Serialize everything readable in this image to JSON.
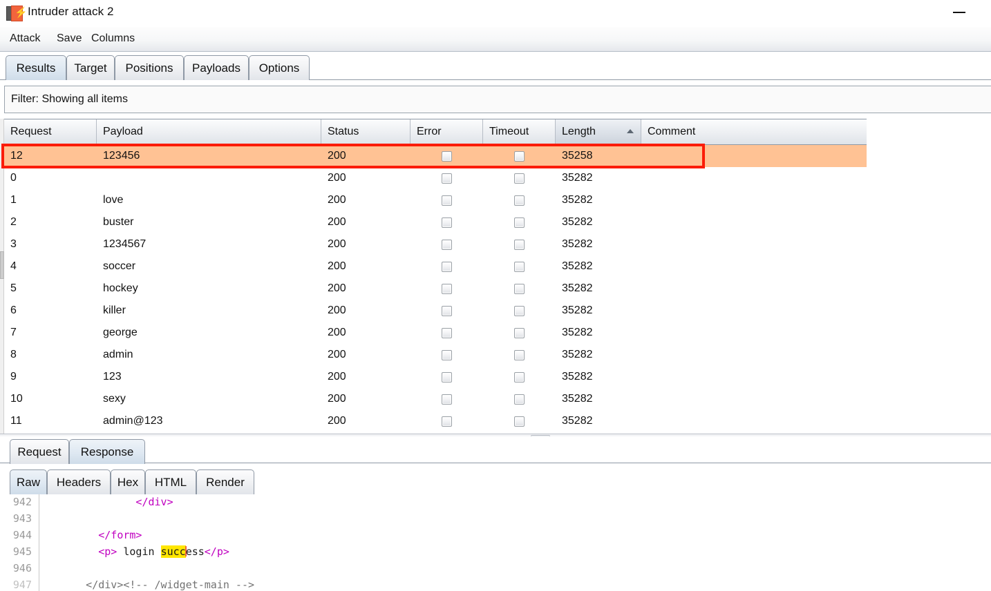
{
  "window": {
    "title": "Intruder attack 2",
    "icon": "burp-suite-icon",
    "minimize_label": "—"
  },
  "menubar": {
    "items": [
      {
        "label": "Attack"
      },
      {
        "label": "Save"
      },
      {
        "label": "Columns"
      }
    ]
  },
  "main_tabs": {
    "active": "Results",
    "items": [
      {
        "label": "Results"
      },
      {
        "label": "Target"
      },
      {
        "label": "Positions"
      },
      {
        "label": "Payloads"
      },
      {
        "label": "Options"
      }
    ]
  },
  "filter": {
    "text": "Filter: Showing all items"
  },
  "results_table": {
    "columns": [
      {
        "label": "Request",
        "sorted": false
      },
      {
        "label": "Payload",
        "sorted": false
      },
      {
        "label": "Status",
        "sorted": false
      },
      {
        "label": "Error",
        "sorted": false
      },
      {
        "label": "Timeout",
        "sorted": false
      },
      {
        "label": "Length",
        "sorted": true,
        "sort_direction": "ascending"
      },
      {
        "label": "Comment",
        "sorted": false
      }
    ],
    "rows": [
      {
        "request": "12",
        "payload": "123456",
        "status": "200",
        "error": false,
        "timeout": false,
        "length": "35258",
        "comment": "",
        "highlighted": true
      },
      {
        "request": "0",
        "payload": "",
        "status": "200",
        "error": false,
        "timeout": false,
        "length": "35282",
        "comment": "",
        "highlighted": false
      },
      {
        "request": "1",
        "payload": "love",
        "status": "200",
        "error": false,
        "timeout": false,
        "length": "35282",
        "comment": "",
        "highlighted": false
      },
      {
        "request": "2",
        "payload": "buster",
        "status": "200",
        "error": false,
        "timeout": false,
        "length": "35282",
        "comment": "",
        "highlighted": false
      },
      {
        "request": "3",
        "payload": "1234567",
        "status": "200",
        "error": false,
        "timeout": false,
        "length": "35282",
        "comment": "",
        "highlighted": false
      },
      {
        "request": "4",
        "payload": "soccer",
        "status": "200",
        "error": false,
        "timeout": false,
        "length": "35282",
        "comment": "",
        "highlighted": false
      },
      {
        "request": "5",
        "payload": "hockey",
        "status": "200",
        "error": false,
        "timeout": false,
        "length": "35282",
        "comment": "",
        "highlighted": false
      },
      {
        "request": "6",
        "payload": "killer",
        "status": "200",
        "error": false,
        "timeout": false,
        "length": "35282",
        "comment": "",
        "highlighted": false
      },
      {
        "request": "7",
        "payload": "george",
        "status": "200",
        "error": false,
        "timeout": false,
        "length": "35282",
        "comment": "",
        "highlighted": false
      },
      {
        "request": "8",
        "payload": "admin",
        "status": "200",
        "error": false,
        "timeout": false,
        "length": "35282",
        "comment": "",
        "highlighted": false
      },
      {
        "request": "9",
        "payload": "123",
        "status": "200",
        "error": false,
        "timeout": false,
        "length": "35282",
        "comment": "",
        "highlighted": false
      },
      {
        "request": "10",
        "payload": "sexy",
        "status": "200",
        "error": false,
        "timeout": false,
        "length": "35282",
        "comment": "",
        "highlighted": false
      },
      {
        "request": "11",
        "payload": "admin@123",
        "status": "200",
        "error": false,
        "timeout": false,
        "length": "35282",
        "comment": "",
        "highlighted": false
      }
    ]
  },
  "annotation": {
    "type": "highlight-rectangle",
    "color": "#fb1c08",
    "target_row": "12"
  },
  "message_tabs": {
    "active": "Response",
    "items": [
      {
        "label": "Request"
      },
      {
        "label": "Response"
      }
    ]
  },
  "view_tabs": {
    "active": "Raw",
    "items": [
      {
        "label": "Raw"
      },
      {
        "label": "Headers"
      },
      {
        "label": "Hex"
      },
      {
        "label": "HTML"
      },
      {
        "label": "Render"
      }
    ]
  },
  "response_body": {
    "search_highlight": "succ",
    "lines": [
      {
        "no": "942",
        "indent": 14,
        "before": "</div>",
        "tag": true
      },
      {
        "no": "943",
        "indent": 0,
        "before": ""
      },
      {
        "no": "944",
        "indent": 8,
        "before": "</form>",
        "tag": true
      },
      {
        "no": "945",
        "indent": 8,
        "before": "<p> login ",
        "highlight": "succ",
        "after": "ess</p>"
      },
      {
        "no": "946",
        "indent": 0,
        "before": ""
      },
      {
        "no": "947",
        "indent": 6,
        "before": "</div><!-- /widget-main -->"
      }
    ]
  },
  "colors": {
    "highlight_row": "#ffc294",
    "annotation_red": "#fb1c08",
    "search_highlight": "#ffe600",
    "tab_active": "#cfdce9",
    "brand_orange": "#f2643d"
  }
}
